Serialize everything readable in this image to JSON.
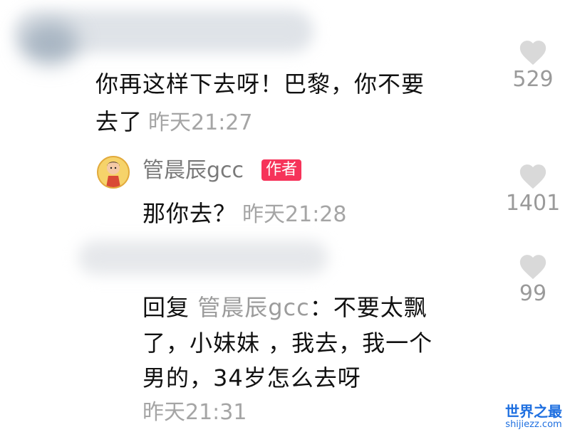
{
  "comments": [
    {
      "text_line1": "你再这样下去呀！巴黎，你不要",
      "text_line2": "去了",
      "time": "昨天21:27",
      "likes": "529"
    },
    {
      "author": "管晨辰gcc",
      "author_tag": "作者",
      "text": "那你去？",
      "time": "昨天21:28",
      "likes": "1401"
    },
    {
      "reply_prefix": "回复 ",
      "reply_to": "管晨辰gcc",
      "line1_rest": "：不要太飘",
      "line2": "了，小妹妹 ，我去，我一个",
      "line3": "男的，34岁怎么去呀",
      "time": "昨天21:31",
      "likes": "99"
    }
  ],
  "watermark": {
    "main": "世界之最",
    "sub": "shijiezz.com"
  },
  "colors": {
    "author_tag_bg": "#f6335a",
    "muted_text": "#a5a5a5",
    "like_icon": "#d9d9d9",
    "watermark": "#1e6fe0"
  },
  "icons": {
    "like": "heart-icon",
    "avatar": "user-avatar"
  }
}
